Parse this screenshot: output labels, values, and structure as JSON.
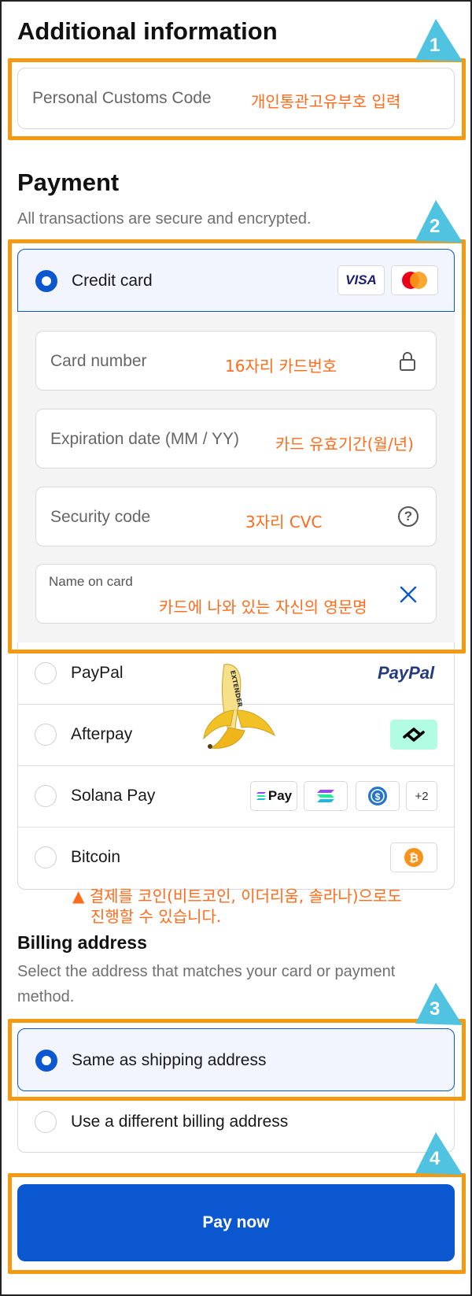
{
  "additional": {
    "title": "Additional information",
    "customs_placeholder": "Personal Customs Code",
    "customs_note": "개인통관고유부호 입력"
  },
  "payment": {
    "title": "Payment",
    "subtitle": "All transactions are secure and encrypted.",
    "credit_card_label": "Credit card",
    "visa_label": "VISA",
    "card_number_placeholder": "Card number",
    "card_number_note": "16자리 카드번호",
    "expiration_placeholder": "Expiration date (MM / YY)",
    "expiration_note": "카드 유효기간(월/년)",
    "security_placeholder": "Security code",
    "security_note": "3자리 CVC",
    "security_help": "?",
    "name_label": "Name on card",
    "name_note": "카드에 나와 있는 자신의 영문명",
    "paypal_label": "PayPal",
    "paypal_logo": "PayPal",
    "afterpay_label": "Afterpay",
    "solana_label": "Solana Pay",
    "solana_chip_text": "Pay",
    "solana_more": "+2",
    "bitcoin_label": "Bitcoin",
    "bitcoin_note_line1": "▲ 결제를 코인(비트코인, 이더리움, 솔라나)으로도",
    "bitcoin_note_line2": "진행할 수 있습니다."
  },
  "billing": {
    "title": "Billing address",
    "subtitle": "Select the address that matches your card or payment method.",
    "same_label": "Same as shipping address",
    "different_label": "Use a different billing address"
  },
  "pay_button": "Pay now",
  "callouts": [
    "1",
    "2",
    "3",
    "4"
  ],
  "watermark": "EXTENDER",
  "colors": {
    "accent": "#0b57d0",
    "annotation": "#ff6b1a",
    "highlight_box": "#f39a12",
    "callout": "#4fc3e0"
  }
}
